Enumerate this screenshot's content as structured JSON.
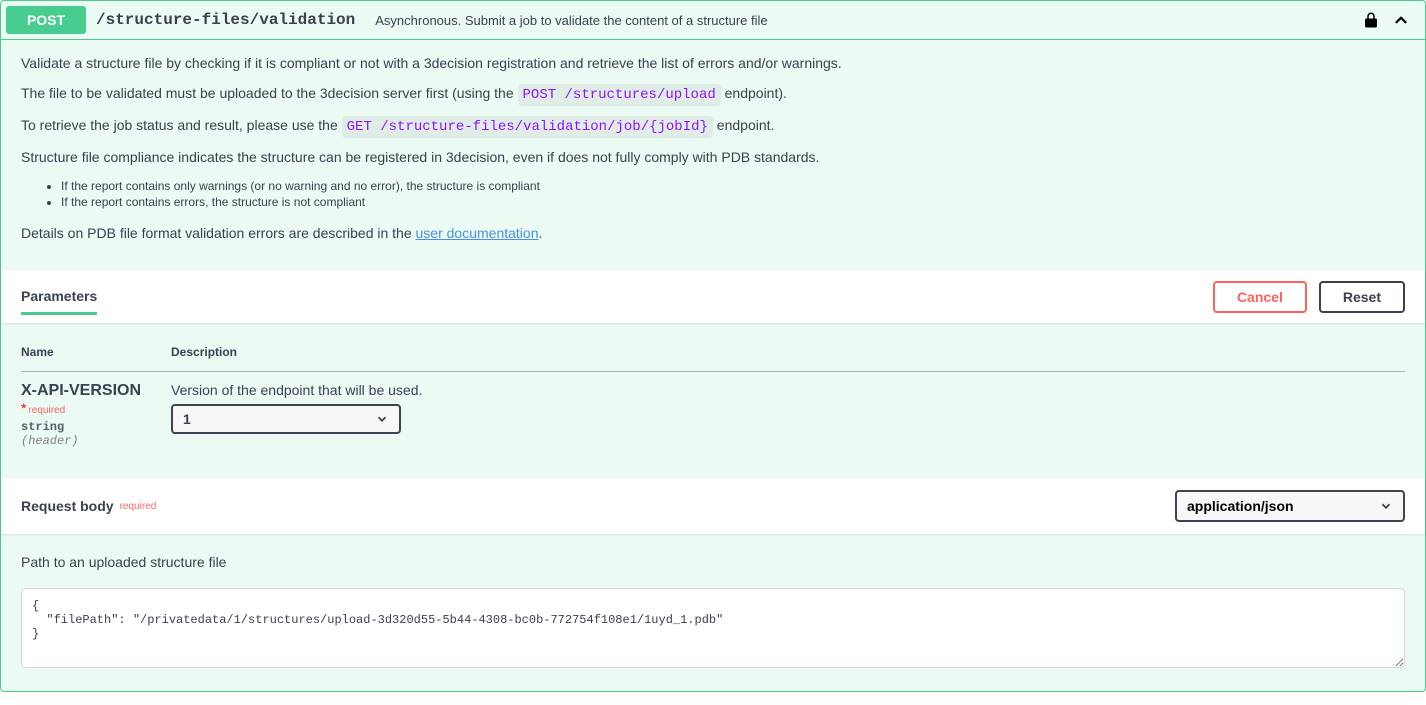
{
  "summary": {
    "method": "POST",
    "path": "/structure-files/validation",
    "description": "Asynchronous. Submit a job to validate the content of a structure file"
  },
  "desc": {
    "p1": "Validate a structure file by checking if it is compliant or not with a 3decision registration and retrieve the list of errors and/or warnings.",
    "p2a": "The file to be validated must be uploaded to the 3decision server first (using the ",
    "p2code": "POST /structures/upload",
    "p2b": " endpoint).",
    "p3a": "To retrieve the job status and result, please use the ",
    "p3code": "GET /structure-files/validation/job/{jobId}",
    "p3b": " endpoint.",
    "p4": "Structure file compliance indicates the structure can be registered in 3decision, even if does not fully comply with PDB standards.",
    "li1": "If the report contains only warnings (or no warning and no error), the structure is compliant",
    "li2": "If the report contains errors, the structure is not compliant",
    "p5a": "Details on PDB file format validation errors are described in the ",
    "p5link": "user documentation",
    "p5b": "."
  },
  "section": {
    "parameters": "Parameters",
    "cancel": "Cancel",
    "reset": "Reset"
  },
  "table": {
    "col_name": "Name",
    "col_desc": "Description"
  },
  "param": {
    "name": "X-API-VERSION",
    "star": " *",
    "required": "required",
    "type": "string",
    "in": "(header)",
    "desc": "Version of the endpoint that will be used.",
    "value": "1"
  },
  "reqbody": {
    "title": "Request body",
    "required": "required",
    "content_type": "application/json",
    "desc": "Path to an uploaded structure file",
    "example": "{\n  \"filePath\": \"/privatedata/1/structures/upload-3d320d55-5b44-4308-bc0b-772754f108e1/1uyd_1.pdb\"\n}"
  }
}
